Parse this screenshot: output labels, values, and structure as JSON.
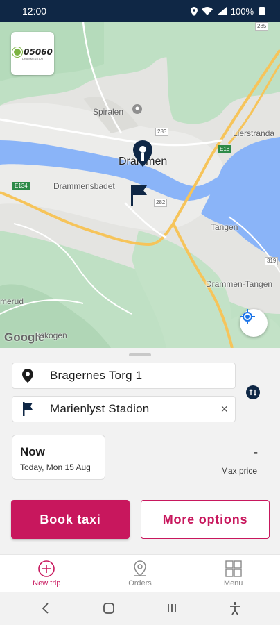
{
  "status_bar": {
    "time": "12:00",
    "battery": "100%",
    "icons": [
      "location-icon",
      "wifi-icon",
      "signal-icon",
      "battery-icon"
    ]
  },
  "map": {
    "logo": {
      "text": "05060",
      "subtext": "DRAMMEN TAXI"
    },
    "labels": {
      "city": "Drammen",
      "spiralen": "Spiralen",
      "drammensbadet": "Drammensbadet",
      "lierstranda": "Lierstranda",
      "tangen": "Tangen",
      "drammen_tangen": "Drammen-Tangen",
      "merud": "merud",
      "skogen": "kskogen"
    },
    "roads": {
      "r285": "285",
      "r283": "283",
      "r282": "282",
      "r319": "319",
      "e18": "E18",
      "e134": "E134"
    },
    "attribution": "Google",
    "colors": {
      "land": "#e6e6e3",
      "green": "#c8e6c9",
      "water": "#8ab4f8",
      "highway": "#f6c45a"
    }
  },
  "trip": {
    "origin": "Bragernes Torg 1",
    "destination": "Marienlyst Stadion",
    "clear_symbol": "×",
    "time_title": "Now",
    "time_sub": "Today, Mon 15 Aug",
    "max_price_value": "-",
    "max_price_label": "Max price"
  },
  "actions": {
    "book": "Book taxi",
    "more": "More options"
  },
  "bottom_nav": {
    "items": [
      {
        "label": "New trip",
        "icon": "plus-circle-icon",
        "active": true
      },
      {
        "label": "Orders",
        "icon": "location-pin-icon",
        "active": false
      },
      {
        "label": "Menu",
        "icon": "grid-icon",
        "active": false
      }
    ]
  },
  "system_nav": {
    "icons": [
      "back-icon",
      "home-icon",
      "recents-icon",
      "accessibility-icon"
    ]
  },
  "colors": {
    "accent": "#c8175d",
    "navy": "#0f2745"
  }
}
